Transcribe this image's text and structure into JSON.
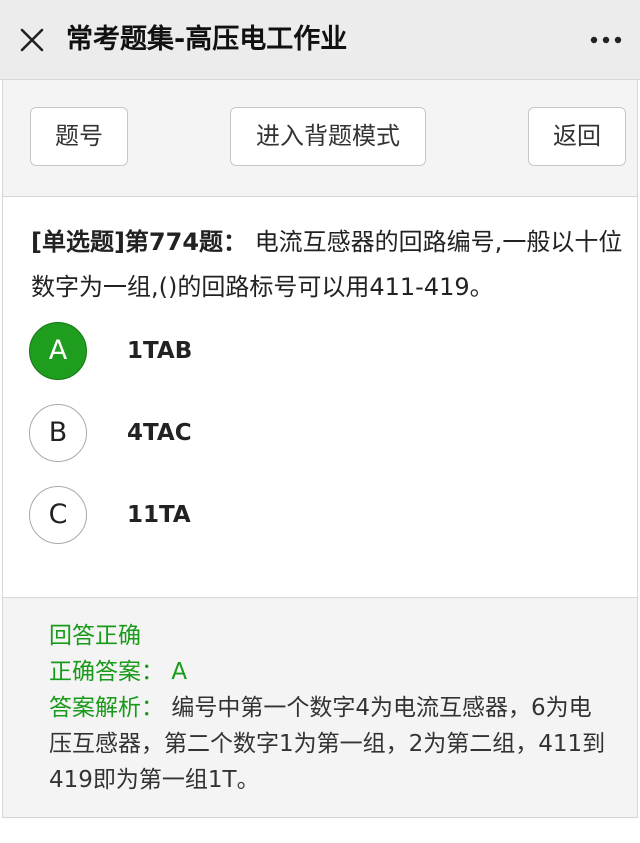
{
  "app": {
    "title": "常考题集-高压电工作业",
    "close_icon": "close-icon",
    "more_icon": "more-icon"
  },
  "toolbar": {
    "number_label": "题号",
    "recite_label": "进入背题模式",
    "back_label": "返回"
  },
  "question": {
    "prefix": "[单选题]第774题：",
    "text": "电流互感器的回路编号,一般以十位数字为一组,()的回路标号可以用411-419。"
  },
  "options": [
    {
      "letter": "A",
      "text": "1TAB",
      "selected": true
    },
    {
      "letter": "B",
      "text": "4TAC",
      "selected": false
    },
    {
      "letter": "C",
      "text": "11TA",
      "selected": false
    }
  ],
  "answer": {
    "status": "回答正确",
    "correct_label": "正确答案：",
    "correct_value": "A",
    "analysis_label": "答案解析：",
    "analysis_text": "编号中第一个数字4为电流互感器，6为电压互感器，第二个数字1为第一组，2为第二组，411到419即为第一组1T。"
  },
  "colors": {
    "accent_green": "#1e9d1e",
    "answer_green": "#1a9a1a",
    "titlebar_bg": "#ececec"
  }
}
